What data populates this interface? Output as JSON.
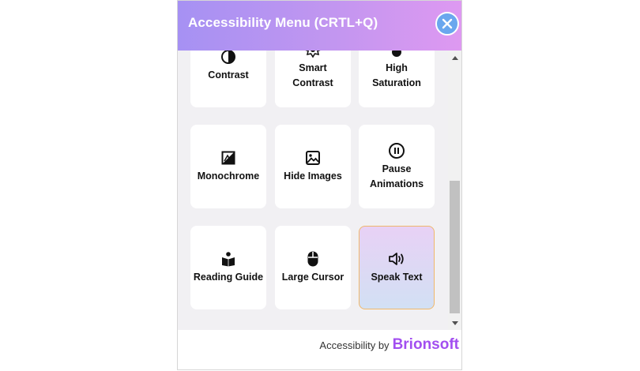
{
  "panel": {
    "title": "Accessibility Menu (CRTL+Q)",
    "close_icon": "close-icon"
  },
  "tiles": [
    {
      "label": "Contrast",
      "icon": "contrast-icon"
    },
    {
      "label": "Smart\nContrast",
      "icon": "smart-contrast-icon"
    },
    {
      "label": "High\nSaturation",
      "icon": "saturation-icon"
    },
    {
      "label": "Monochrome",
      "icon": "monochrome-icon"
    },
    {
      "label": "Hide Images",
      "icon": "image-icon"
    },
    {
      "label": "Pause\nAnimations",
      "icon": "pause-icon"
    },
    {
      "label": "Reading Guide",
      "icon": "reading-guide-icon"
    },
    {
      "label": "Large Cursor",
      "icon": "mouse-icon"
    },
    {
      "label": "Speak Text",
      "icon": "speaker-icon",
      "active": true
    }
  ],
  "footer": {
    "by_text": "Accessibility by",
    "brand": "Brionsoft"
  },
  "colors": {
    "header_start": "#a691f3",
    "header_end": "#de99f1",
    "close_button": "#6aa7ee",
    "brand": "#a24ef0",
    "active_border": "#f0b76b"
  }
}
